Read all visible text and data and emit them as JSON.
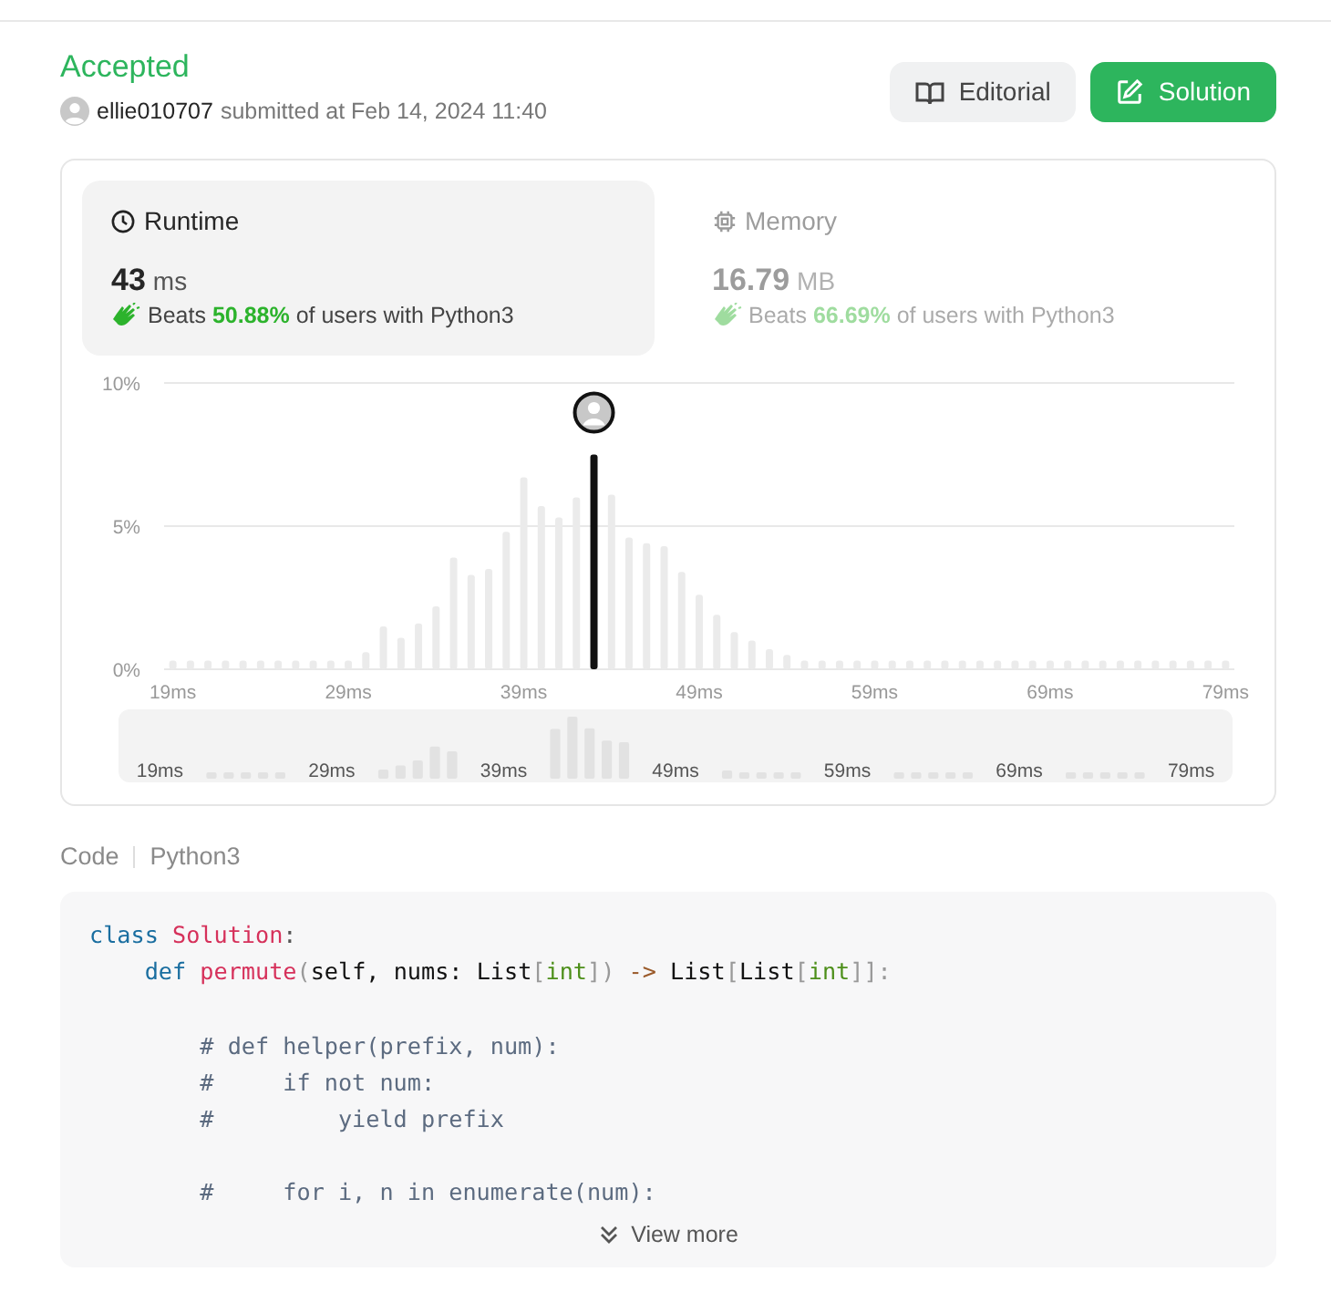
{
  "submission": {
    "status": "Accepted",
    "user": "ellie010707",
    "submitted_text": "submitted at Feb 14, 2024 11:40"
  },
  "buttons": [
    {
      "label": "Editorial",
      "kind": "secondary"
    },
    {
      "label": "Solution",
      "kind": "primary"
    }
  ],
  "metrics": [
    {
      "kind": "runtime",
      "title": "Runtime",
      "value": "43",
      "unit": "ms",
      "beats_label": "Beats",
      "beats_value": "50.88%",
      "beats_suffix": "of users with Python3",
      "selected": true
    },
    {
      "kind": "memory",
      "title": "Memory",
      "value": "16.79",
      "unit": "MB",
      "beats_label": "Beats",
      "beats_value": "66.69%",
      "beats_suffix": "of users with Python3",
      "selected": false
    }
  ],
  "chart_data": {
    "type": "bar",
    "x": [
      19,
      20,
      21,
      22,
      23,
      24,
      25,
      26,
      27,
      28,
      29,
      30,
      31,
      32,
      33,
      34,
      35,
      36,
      37,
      38,
      39,
      40,
      41,
      42,
      43,
      44,
      45,
      46,
      47,
      48,
      49,
      50,
      51,
      52,
      53,
      54,
      55,
      56,
      57,
      58,
      59,
      60,
      61,
      62,
      63,
      64,
      65,
      66,
      67,
      68,
      69,
      70,
      71,
      72,
      73,
      74,
      75,
      76,
      77,
      78,
      79
    ],
    "series": [
      {
        "color": "#ebebeb",
        "values": [
          0.3,
          0.3,
          0.3,
          0.3,
          0.3,
          0.3,
          0.3,
          0.3,
          0.3,
          0.3,
          0.3,
          0.6,
          1.5,
          1.1,
          1.6,
          2.2,
          3.9,
          3.3,
          3.5,
          4.8,
          6.7,
          5.7,
          5.3,
          6.0,
          null,
          6.1,
          4.6,
          4.4,
          4.3,
          3.4,
          2.6,
          1.9,
          1.3,
          1.0,
          0.7,
          0.5,
          0.3,
          0.3,
          0.3,
          0.3,
          0.3,
          0.3,
          0.3,
          0.3,
          0.3,
          0.3,
          0.3,
          0.3,
          0.3,
          0.3,
          0.3,
          0.3,
          0.3,
          0.3,
          0.3,
          0.3,
          0.3,
          0.3,
          0.3,
          0.3,
          0.3
        ]
      },
      {
        "color": "#111111",
        "values": [
          null,
          null,
          null,
          null,
          null,
          null,
          null,
          null,
          null,
          null,
          null,
          null,
          null,
          null,
          null,
          null,
          null,
          null,
          null,
          null,
          null,
          null,
          null,
          null,
          7.5,
          null,
          null,
          null,
          null,
          null,
          null,
          null,
          null,
          null,
          null,
          null,
          null,
          null,
          null,
          null,
          null,
          null,
          null,
          null,
          null,
          null,
          null,
          null,
          null,
          null,
          null,
          null,
          null,
          null,
          null,
          null,
          null,
          null,
          null,
          null,
          null
        ]
      }
    ],
    "xlim": [
      18.5,
      79.5
    ],
    "ylim": [
      0,
      10
    ],
    "yticks": [
      {
        "value": 0,
        "label": "0%"
      },
      {
        "value": 5,
        "label": "5%"
      },
      {
        "value": 10,
        "label": "10%"
      }
    ],
    "xticks": [
      {
        "value": 19,
        "label": "19ms"
      },
      {
        "value": 29,
        "label": "29ms"
      },
      {
        "value": 39,
        "label": "39ms"
      },
      {
        "value": 49,
        "label": "49ms"
      },
      {
        "value": 59,
        "label": "59ms"
      },
      {
        "value": 69,
        "label": "69ms"
      },
      {
        "value": 79,
        "label": "79ms"
      }
    ]
  },
  "overview": {
    "tick_labels": [
      "19ms",
      "29ms",
      "39ms",
      "49ms",
      "59ms",
      "69ms",
      "79ms"
    ]
  },
  "code": {
    "label": "Code",
    "language": "Python3",
    "blocks": [
      {
        "lines": [
          {
            "tokens": [
              {
                "t": "class ",
                "kind": "keyword"
              },
              {
                "t": "Solution",
                "kind": "name"
              },
              {
                "t": ":",
                "kind": "punct"
              }
            ]
          },
          {
            "tokens": [
              {
                "t": "    def ",
                "kind": "keyword"
              },
              {
                "t": "permute",
                "kind": "name"
              },
              {
                "t": "(",
                "kind": "bracket"
              },
              {
                "t": "self, nums: List",
                "kind": "plain"
              },
              {
                "t": "[",
                "kind": "bracket"
              },
              {
                "t": "int",
                "kind": "builtin"
              },
              {
                "t": "]) ",
                "kind": "bracket"
              },
              {
                "t": "->",
                "kind": "operator"
              },
              {
                "t": " List",
                "kind": "plain"
              },
              {
                "t": "[",
                "kind": "bracket"
              },
              {
                "t": "List",
                "kind": "plain"
              },
              {
                "t": "[",
                "kind": "bracket"
              },
              {
                "t": "int",
                "kind": "builtin"
              },
              {
                "t": "]]:",
                "kind": "bracket"
              }
            ]
          }
        ]
      },
      {
        "lines": [
          {
            "tokens": [
              {
                "t": "        # def helper(prefix, num):",
                "kind": "comment"
              }
            ]
          },
          {
            "tokens": [
              {
                "t": "        #     if not num:",
                "kind": "comment"
              }
            ]
          },
          {
            "tokens": [
              {
                "t": "        #         yield prefix",
                "kind": "comment"
              }
            ]
          }
        ]
      },
      {
        "lines": [
          {
            "tokens": [
              {
                "t": "        #     for i, n in enumerate(num):",
                "kind": "comment"
              }
            ]
          }
        ]
      }
    ],
    "more_label": "View more"
  }
}
